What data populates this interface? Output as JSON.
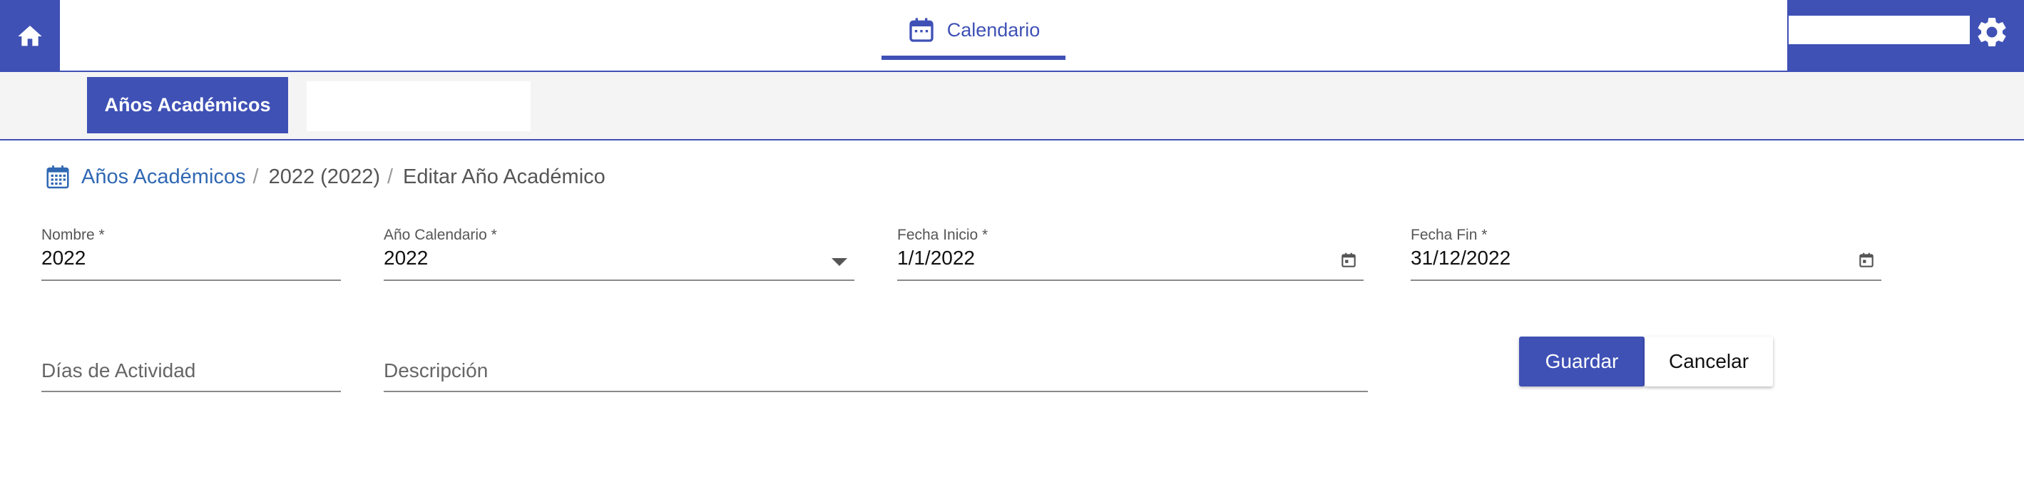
{
  "colors": {
    "primary": "#3f51b5",
    "link": "#3068b3",
    "subnav_bg": "#f4f4f4"
  },
  "topbar": {
    "home_icon": "home-icon",
    "center_tab": {
      "icon": "calendar-icon",
      "label": "Calendario"
    },
    "search_input_value": "",
    "settings_icon": "gear-icon"
  },
  "subnav": {
    "active_label": "Años Académicos"
  },
  "breadcrumb": {
    "icon": "calendar-icon",
    "items": [
      "Años Académicos",
      "2022 (2022)",
      "Editar Año Académico"
    ],
    "separator": "/"
  },
  "form": {
    "nombre": {
      "label": "Nombre *",
      "value": "2022"
    },
    "anio_calendario": {
      "label": "Año Calendario *",
      "value": "2022"
    },
    "fecha_inicio": {
      "label": "Fecha Inicio *",
      "value": "1/1/2022"
    },
    "fecha_fin": {
      "label": "Fecha Fin *",
      "value": "31/12/2022"
    },
    "dias_actividad": {
      "placeholder": "Días de Actividad"
    },
    "descripcion": {
      "placeholder": "Descripción"
    }
  },
  "actions": {
    "save_label": "Guardar",
    "cancel_label": "Cancelar"
  }
}
